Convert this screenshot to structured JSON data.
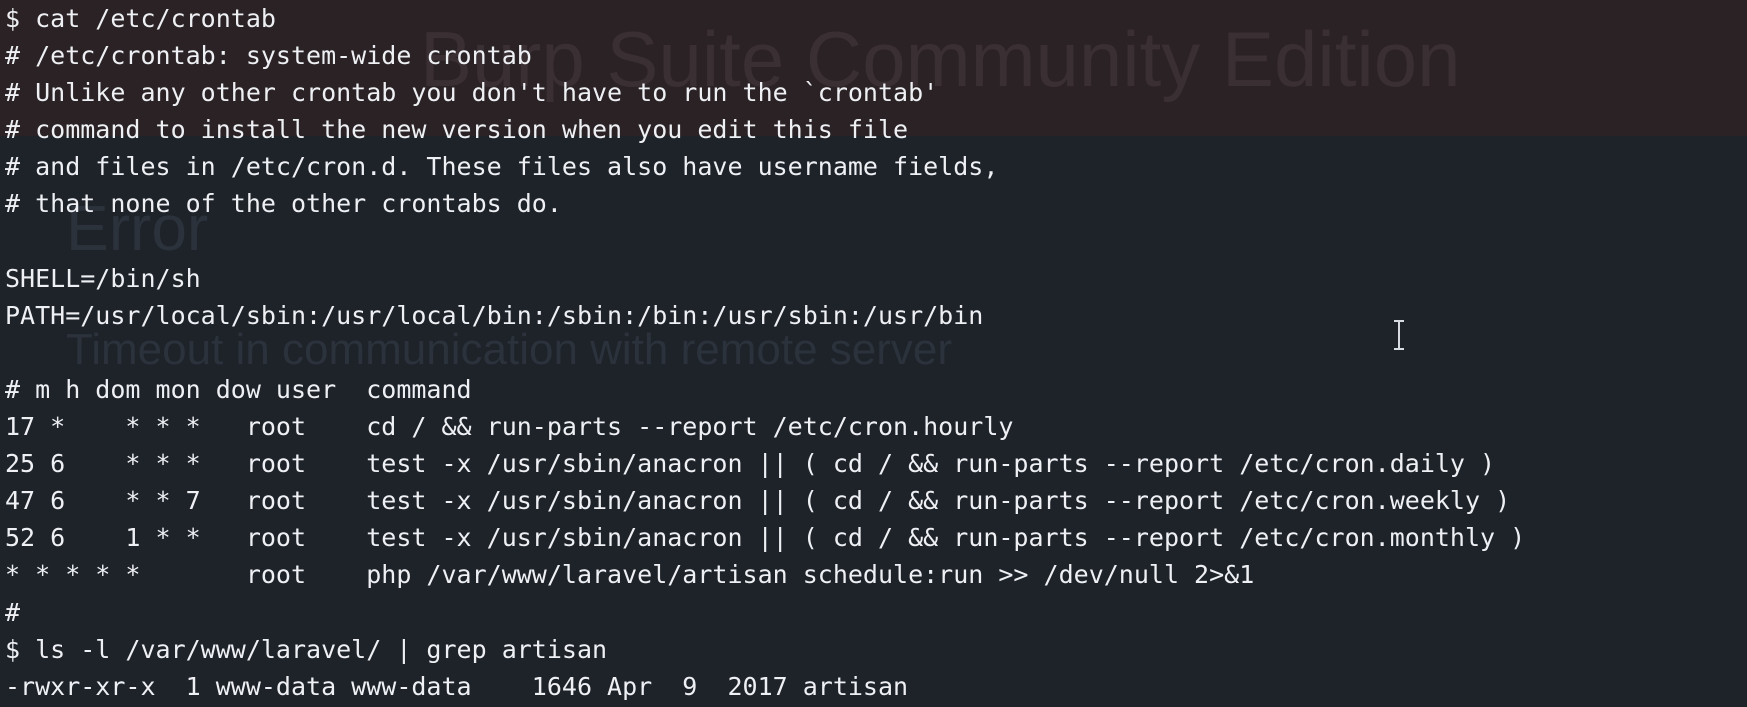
{
  "background": {
    "title": "Burp Suite Community Edition",
    "error_heading": "Error",
    "error_message": "Timeout in communication with remote server"
  },
  "terminal": {
    "lines": [
      "$ cat /etc/crontab",
      "# /etc/crontab: system-wide crontab",
      "# Unlike any other crontab you don't have to run the `crontab'",
      "# command to install the new version when you edit this file",
      "# and files in /etc/cron.d. These files also have username fields,",
      "# that none of the other crontabs do.",
      "",
      "SHELL=/bin/sh",
      "PATH=/usr/local/sbin:/usr/local/bin:/sbin:/bin:/usr/sbin:/usr/bin",
      "",
      "# m h dom mon dow user  command",
      "17 *    * * *   root    cd / && run-parts --report /etc/cron.hourly",
      "25 6    * * *   root    test -x /usr/sbin/anacron || ( cd / && run-parts --report /etc/cron.daily )",
      "47 6    * * 7   root    test -x /usr/sbin/anacron || ( cd / && run-parts --report /etc/cron.weekly )",
      "52 6    1 * *   root    test -x /usr/sbin/anacron || ( cd / && run-parts --report /etc/cron.monthly )",
      "* * * * *       root    php /var/www/laravel/artisan schedule:run >> /dev/null 2>&1",
      "#",
      "$ ls -l /var/www/laravel/ | grep artisan",
      "-rwxr-xr-x  1 www-data www-data    1646 Apr  9  2017 artisan"
    ]
  },
  "colors": {
    "terminal_bg": "#1e232a",
    "text": "#eef0f4",
    "ghost_band": "#2a2225"
  },
  "icons": {
    "cursor": "text-cursor-icon"
  }
}
